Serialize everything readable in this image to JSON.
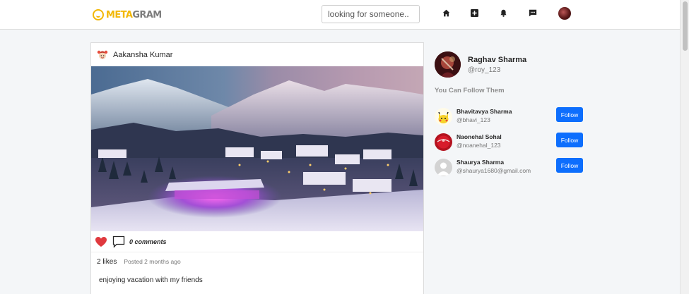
{
  "navbar": {
    "logo_part1": "META",
    "logo_part2": "GRAM",
    "search_placeholder": "looking for someone..",
    "icons": [
      "home-icon",
      "plus-square-icon",
      "bell-icon",
      "chat-icon"
    ]
  },
  "post": {
    "author": "Aakansha Kumar",
    "comments": "0 comments",
    "likes": "2 likes",
    "posted": "Posted 2 months ago",
    "caption": "enjoying vacation with my friends",
    "liked": true
  },
  "profile": {
    "name": "Raghav Sharma",
    "handle": "@roy_123"
  },
  "suggestions": {
    "title": "You Can Follow Them",
    "users": [
      {
        "name": "Bhavitavya Sharma",
        "handle": "@bhavi_123",
        "button": "Follow"
      },
      {
        "name": "Naonehal Sohal",
        "handle": "@noanehal_123",
        "button": "Follow"
      },
      {
        "name": "Shaurya Sharma",
        "handle": "@shaurya1680@gmail.com",
        "button": "Follow"
      }
    ]
  },
  "colors": {
    "accent": "#0d6efd",
    "heart": "#e0393e",
    "logo": "#f2b705"
  }
}
